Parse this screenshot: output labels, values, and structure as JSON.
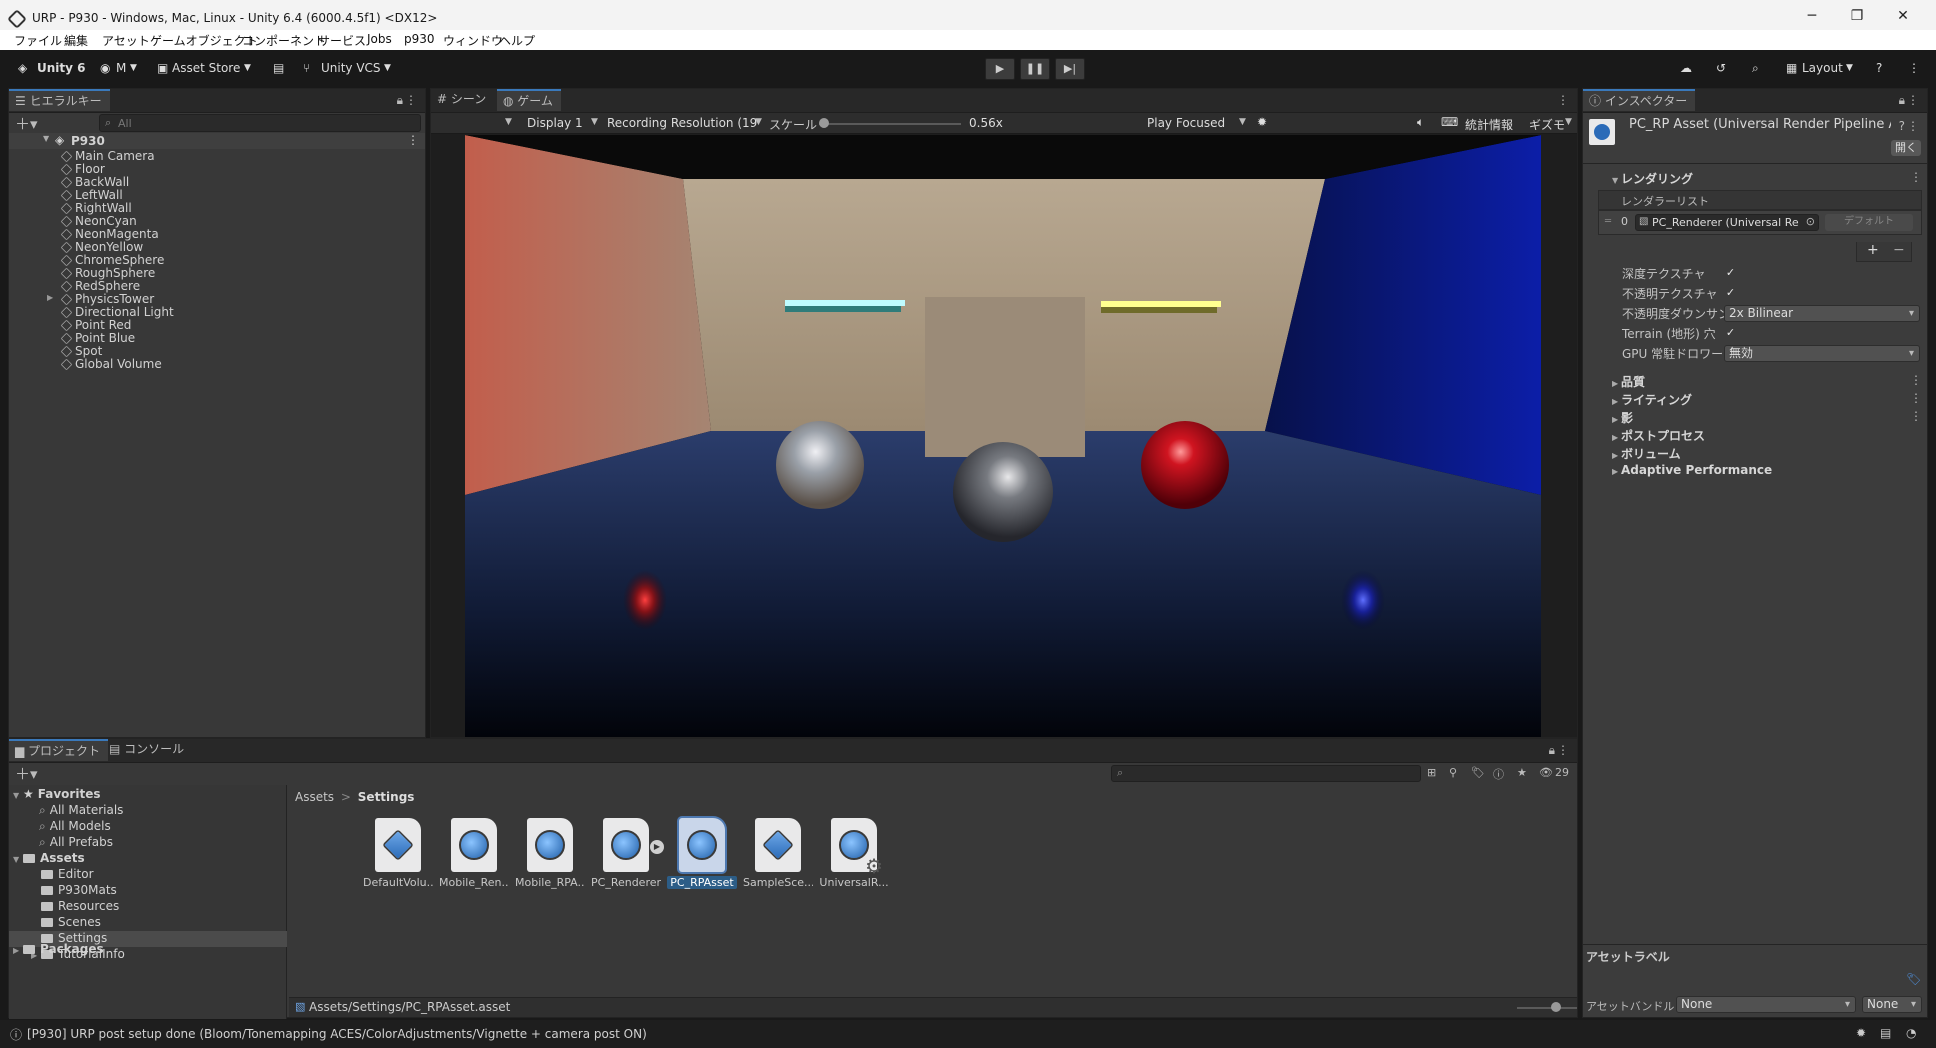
{
  "titlebar": {
    "title": "URP - P930 - Windows, Mac, Linux - Unity 6.4 (6000.4.5f1) <DX12>",
    "minimize": "─",
    "maximize": "❐",
    "close": "✕"
  },
  "menu": [
    "ファイル",
    "編集",
    "アセット",
    "ゲームオブジェクト",
    "コンポーネント",
    "サービス",
    "Jobs",
    "p930",
    "ウィンドウ",
    "ヘルプ"
  ],
  "toolbar": {
    "unity_label": "Unity 6",
    "account_label": "M",
    "asset_store_label": "Asset Store",
    "vcs_label": "Unity VCS",
    "layout_label": "Layout"
  },
  "hierarchy": {
    "tab_label": "ヒエラルキー",
    "search_placeholder": "All",
    "scene_name": "P930",
    "items": [
      {
        "label": "Main Camera",
        "expandable": false
      },
      {
        "label": "Floor",
        "expandable": false
      },
      {
        "label": "BackWall",
        "expandable": false
      },
      {
        "label": "LeftWall",
        "expandable": false
      },
      {
        "label": "RightWall",
        "expandable": false
      },
      {
        "label": "NeonCyan",
        "expandable": false
      },
      {
        "label": "NeonMagenta",
        "expandable": false
      },
      {
        "label": "NeonYellow",
        "expandable": false
      },
      {
        "label": "ChromeSphere",
        "expandable": false
      },
      {
        "label": "RoughSphere",
        "expandable": false
      },
      {
        "label": "RedSphere",
        "expandable": false
      },
      {
        "label": "PhysicsTower",
        "expandable": true
      },
      {
        "label": "Directional Light",
        "expandable": false
      },
      {
        "label": "Point Red",
        "expandable": false
      },
      {
        "label": "Point Blue",
        "expandable": false
      },
      {
        "label": "Spot",
        "expandable": false
      },
      {
        "label": "Global Volume",
        "expandable": false
      }
    ]
  },
  "game": {
    "scene_tab": "シーン",
    "game_tab": "ゲーム",
    "display": "Display 1",
    "resolution": "Recording Resolution (19",
    "scale_label": "スケール",
    "scale_value": "0.56x",
    "play_mode": "Play Focused",
    "stats_label": "統計情報",
    "gizmos_label": "ギズモ"
  },
  "inspector": {
    "tab_label": "インスペクター",
    "asset_title": "PC_RP Asset (Universal Render Pipeline As",
    "open_button": "開く",
    "rendering_section": "レンダリング",
    "renderer_list_label": "レンダラーリスト",
    "renderer_index": "0",
    "renderer_value": "PC_Renderer (Universal Re",
    "renderer_default": "デフォルト",
    "add_label": "+",
    "remove_label": "−",
    "props": [
      {
        "label": "深度テクスチャ",
        "kind": "check",
        "value": "✓"
      },
      {
        "label": "不透明テクスチャ",
        "kind": "check",
        "value": "✓"
      },
      {
        "label": "不透明度ダウンサンプ",
        "kind": "dropdown",
        "value": "2x Bilinear"
      },
      {
        "label": "Terrain (地形) 穴",
        "kind": "check",
        "value": "✓"
      },
      {
        "label": "GPU 常駐ドロワー",
        "kind": "dropdown",
        "value": "無効"
      }
    ],
    "sections": [
      "品質",
      "ライティング",
      "影",
      "ポストプロセス",
      "ボリューム",
      "Adaptive Performance"
    ],
    "asset_labels": "アセットラベル",
    "asset_bundle_label": "アセットバンドル",
    "asset_bundle_value": "None",
    "asset_bundle_variant": "None"
  },
  "project": {
    "project_tab": "プロジェクト",
    "console_tab": "コンソール",
    "hidden_count": "29",
    "favorites_label": "Favorites",
    "favorites": [
      "All Materials",
      "All Models",
      "All Prefabs"
    ],
    "assets_label": "Assets",
    "asset_folders": [
      {
        "label": "Editor",
        "expandable": false
      },
      {
        "label": "P930Mats",
        "expandable": false
      },
      {
        "label": "Resources",
        "expandable": false
      },
      {
        "label": "Scenes",
        "expandable": false
      },
      {
        "label": "Settings",
        "expandable": false
      },
      {
        "label": "TutorialInfo",
        "expandable": true
      }
    ],
    "packages_label": "Packages",
    "breadcrumb_root": "Assets",
    "breadcrumb_sep": ">",
    "breadcrumb_current": "Settings",
    "files": [
      {
        "label": "DefaultVolu...",
        "icon": "volume-profile-icon"
      },
      {
        "label": "Mobile_Ren...",
        "icon": "urp-asset-icon"
      },
      {
        "label": "Mobile_RPA...",
        "icon": "urp-asset-icon"
      },
      {
        "label": "PC_Renderer",
        "icon": "urp-asset-icon"
      },
      {
        "label": "PC_RPAsset",
        "icon": "urp-asset-icon"
      },
      {
        "label": "SampleSce...",
        "icon": "volume-profile-icon"
      },
      {
        "label": "UniversalR...",
        "icon": "urp-settings-icon"
      }
    ],
    "selected_file": "PC_RPAsset",
    "selected_path": "Assets/Settings/PC_RPAsset.asset"
  },
  "statusbar": {
    "message": "[P930] URP post setup done (Bloom/Tonemapping ACES/ColorAdjustments/Vignette + camera post ON)"
  }
}
